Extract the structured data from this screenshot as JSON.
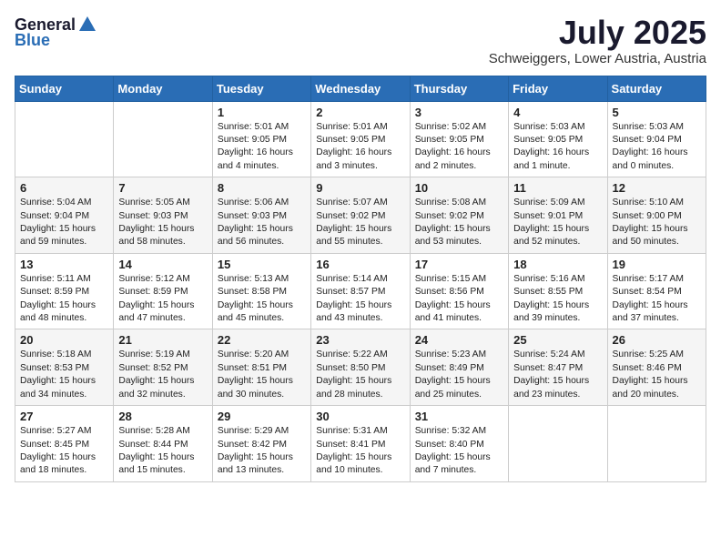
{
  "logo": {
    "general": "General",
    "blue": "Blue"
  },
  "title": {
    "month": "July 2025",
    "location": "Schweiggers, Lower Austria, Austria"
  },
  "days_of_week": [
    "Sunday",
    "Monday",
    "Tuesday",
    "Wednesday",
    "Thursday",
    "Friday",
    "Saturday"
  ],
  "weeks": [
    [
      {
        "day": "",
        "content": ""
      },
      {
        "day": "",
        "content": ""
      },
      {
        "day": "1",
        "content": "Sunrise: 5:01 AM\nSunset: 9:05 PM\nDaylight: 16 hours and 4 minutes."
      },
      {
        "day": "2",
        "content": "Sunrise: 5:01 AM\nSunset: 9:05 PM\nDaylight: 16 hours and 3 minutes."
      },
      {
        "day": "3",
        "content": "Sunrise: 5:02 AM\nSunset: 9:05 PM\nDaylight: 16 hours and 2 minutes."
      },
      {
        "day": "4",
        "content": "Sunrise: 5:03 AM\nSunset: 9:05 PM\nDaylight: 16 hours and 1 minute."
      },
      {
        "day": "5",
        "content": "Sunrise: 5:03 AM\nSunset: 9:04 PM\nDaylight: 16 hours and 0 minutes."
      }
    ],
    [
      {
        "day": "6",
        "content": "Sunrise: 5:04 AM\nSunset: 9:04 PM\nDaylight: 15 hours and 59 minutes."
      },
      {
        "day": "7",
        "content": "Sunrise: 5:05 AM\nSunset: 9:03 PM\nDaylight: 15 hours and 58 minutes."
      },
      {
        "day": "8",
        "content": "Sunrise: 5:06 AM\nSunset: 9:03 PM\nDaylight: 15 hours and 56 minutes."
      },
      {
        "day": "9",
        "content": "Sunrise: 5:07 AM\nSunset: 9:02 PM\nDaylight: 15 hours and 55 minutes."
      },
      {
        "day": "10",
        "content": "Sunrise: 5:08 AM\nSunset: 9:02 PM\nDaylight: 15 hours and 53 minutes."
      },
      {
        "day": "11",
        "content": "Sunrise: 5:09 AM\nSunset: 9:01 PM\nDaylight: 15 hours and 52 minutes."
      },
      {
        "day": "12",
        "content": "Sunrise: 5:10 AM\nSunset: 9:00 PM\nDaylight: 15 hours and 50 minutes."
      }
    ],
    [
      {
        "day": "13",
        "content": "Sunrise: 5:11 AM\nSunset: 8:59 PM\nDaylight: 15 hours and 48 minutes."
      },
      {
        "day": "14",
        "content": "Sunrise: 5:12 AM\nSunset: 8:59 PM\nDaylight: 15 hours and 47 minutes."
      },
      {
        "day": "15",
        "content": "Sunrise: 5:13 AM\nSunset: 8:58 PM\nDaylight: 15 hours and 45 minutes."
      },
      {
        "day": "16",
        "content": "Sunrise: 5:14 AM\nSunset: 8:57 PM\nDaylight: 15 hours and 43 minutes."
      },
      {
        "day": "17",
        "content": "Sunrise: 5:15 AM\nSunset: 8:56 PM\nDaylight: 15 hours and 41 minutes."
      },
      {
        "day": "18",
        "content": "Sunrise: 5:16 AM\nSunset: 8:55 PM\nDaylight: 15 hours and 39 minutes."
      },
      {
        "day": "19",
        "content": "Sunrise: 5:17 AM\nSunset: 8:54 PM\nDaylight: 15 hours and 37 minutes."
      }
    ],
    [
      {
        "day": "20",
        "content": "Sunrise: 5:18 AM\nSunset: 8:53 PM\nDaylight: 15 hours and 34 minutes."
      },
      {
        "day": "21",
        "content": "Sunrise: 5:19 AM\nSunset: 8:52 PM\nDaylight: 15 hours and 32 minutes."
      },
      {
        "day": "22",
        "content": "Sunrise: 5:20 AM\nSunset: 8:51 PM\nDaylight: 15 hours and 30 minutes."
      },
      {
        "day": "23",
        "content": "Sunrise: 5:22 AM\nSunset: 8:50 PM\nDaylight: 15 hours and 28 minutes."
      },
      {
        "day": "24",
        "content": "Sunrise: 5:23 AM\nSunset: 8:49 PM\nDaylight: 15 hours and 25 minutes."
      },
      {
        "day": "25",
        "content": "Sunrise: 5:24 AM\nSunset: 8:47 PM\nDaylight: 15 hours and 23 minutes."
      },
      {
        "day": "26",
        "content": "Sunrise: 5:25 AM\nSunset: 8:46 PM\nDaylight: 15 hours and 20 minutes."
      }
    ],
    [
      {
        "day": "27",
        "content": "Sunrise: 5:27 AM\nSunset: 8:45 PM\nDaylight: 15 hours and 18 minutes."
      },
      {
        "day": "28",
        "content": "Sunrise: 5:28 AM\nSunset: 8:44 PM\nDaylight: 15 hours and 15 minutes."
      },
      {
        "day": "29",
        "content": "Sunrise: 5:29 AM\nSunset: 8:42 PM\nDaylight: 15 hours and 13 minutes."
      },
      {
        "day": "30",
        "content": "Sunrise: 5:31 AM\nSunset: 8:41 PM\nDaylight: 15 hours and 10 minutes."
      },
      {
        "day": "31",
        "content": "Sunrise: 5:32 AM\nSunset: 8:40 PM\nDaylight: 15 hours and 7 minutes."
      },
      {
        "day": "",
        "content": ""
      },
      {
        "day": "",
        "content": ""
      }
    ]
  ]
}
